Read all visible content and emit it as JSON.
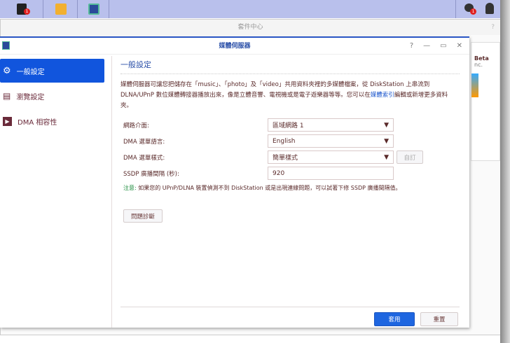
{
  "taskbar": {
    "badge_apps": "1",
    "badge_notifications": "1"
  },
  "package_center": {
    "title": "套件中心",
    "help": "?",
    "beta_label": "Beta",
    "inc_text": "nc."
  },
  "dialog": {
    "title": "媒體伺服器",
    "help": "?",
    "minimize": "—",
    "maximize": "▭",
    "close": "✕"
  },
  "sidebar": {
    "items": [
      {
        "label": "一般設定"
      },
      {
        "label": "瀏覽設定"
      },
      {
        "label": "DMA 相容性"
      }
    ]
  },
  "main": {
    "heading": "一般設定",
    "desc_part1": "媒體伺服器可讓您把儲存在「music」、「photo」及「video」共用資料夾裡的多媒體檔案，從 DiskStation 上串流到 DLNA/UPnP 數位媒體轉接器播放出來，像是立體音響、電視機或是電子遊樂器等等。您可以在",
    "desc_link": "媒體索引",
    "desc_part2": "編輯或新增更多資料夾。",
    "fields": [
      {
        "label": "網路介面:",
        "value": "區域網路 1"
      },
      {
        "label": "DMA 選單語言:",
        "value": "English"
      },
      {
        "label": "DMA 選單樣式:",
        "value": "簡單樣式"
      },
      {
        "label": "SSDP 廣播間隔 (秒):",
        "value": "920"
      }
    ],
    "customize_button": "自訂",
    "note_label": "注意:",
    "note_text": " 如果您的 UPnP/DLNA 裝置偵測不到 DiskStation 或是出現連線問題，可以試著下修 SSDP 廣播間隔值。",
    "diagnose_button": "問題診斷"
  },
  "footer": {
    "apply": "套用",
    "reset": "重置"
  }
}
